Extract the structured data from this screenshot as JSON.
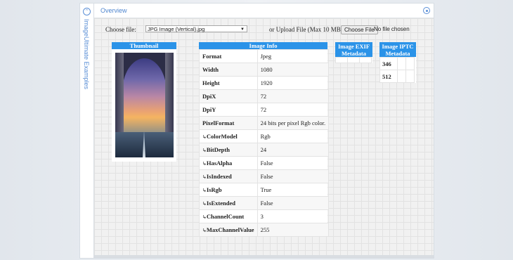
{
  "sidebar": {
    "label": "ImageUltimate Examples",
    "icon": "chevron-up-icon"
  },
  "panel": {
    "title": "Overview",
    "settings_icon": "gear-icon"
  },
  "file": {
    "choose_label": "Choose file:",
    "selected": "JPG Image (Vertical).jpg",
    "upload_label": "or Upload File (Max 10 MB):",
    "upload_button": "Choose File",
    "upload_status": "No file chosen"
  },
  "thumbnail": {
    "header": "Thumbnail"
  },
  "image_info": {
    "header": "Image Info",
    "rows": [
      {
        "key": "Format",
        "value": "Jpeg"
      },
      {
        "key": "Width",
        "value": "1080"
      },
      {
        "key": "Height",
        "value": "1920"
      },
      {
        "key": "DpiX",
        "value": "72"
      },
      {
        "key": "DpiY",
        "value": "72"
      },
      {
        "key": "PixelFormat",
        "value": "24 bits per pixel Rgb color."
      },
      {
        "key": "ColorModel",
        "value": "Rgb"
      },
      {
        "key": "BitDepth",
        "value": "24"
      },
      {
        "key": "HasAlpha",
        "value": "False"
      },
      {
        "key": "IsIndexed",
        "value": "False"
      },
      {
        "key": "IsRgb",
        "value": "True"
      },
      {
        "key": "IsExtended",
        "value": "False"
      },
      {
        "key": "ChannelCount",
        "value": "3"
      },
      {
        "key": "MaxChannelValue",
        "value": "255"
      }
    ]
  },
  "exif": {
    "header_line1": "Image EXIF",
    "header_line2": "Metadata"
  },
  "iptc": {
    "header_line1": "Image IPTC",
    "header_line2": "Metadata",
    "rows": [
      "346",
      "512"
    ]
  },
  "colors": {
    "accent": "#2b93e8",
    "link": "#4f86cf"
  }
}
